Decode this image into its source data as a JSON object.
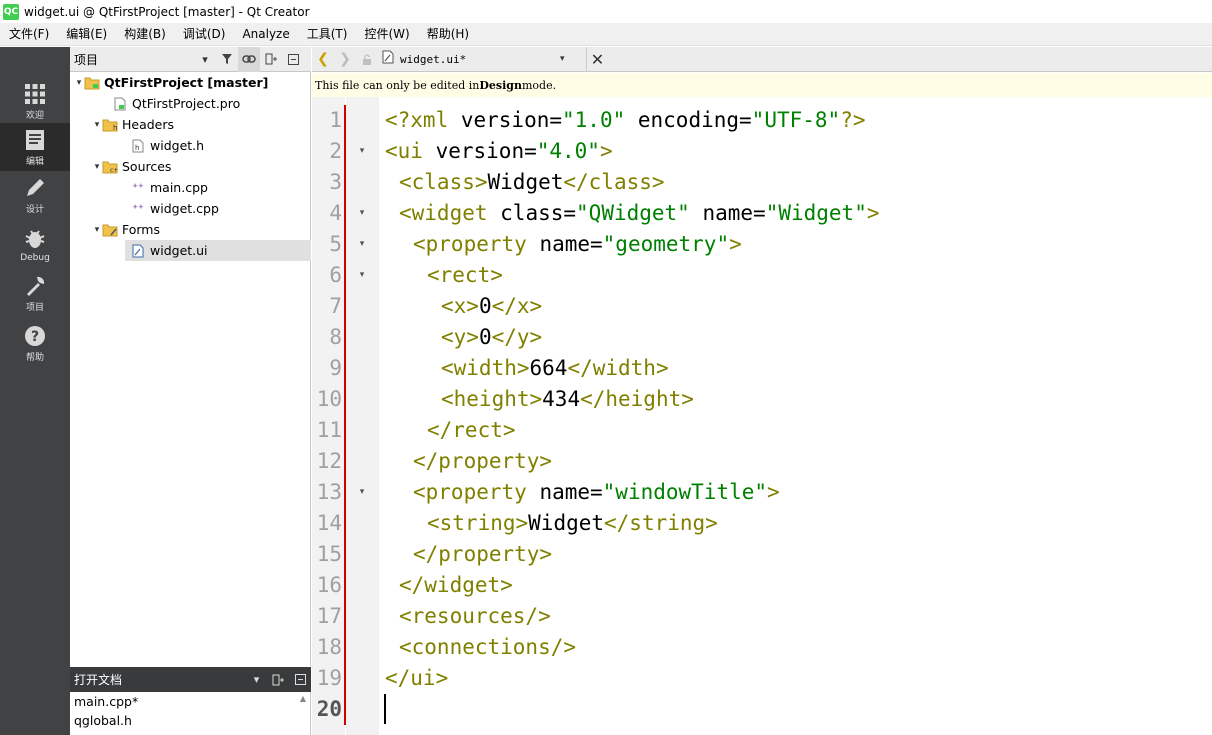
{
  "window": {
    "title": "widget.ui @ QtFirstProject [master] - Qt Creator",
    "app_icon_text": "QC"
  },
  "menu": [
    "文件(F)",
    "编辑(E)",
    "构建(B)",
    "调试(D)",
    "Analyze",
    "工具(T)",
    "控件(W)",
    "帮助(H)"
  ],
  "modes": [
    {
      "label": "欢迎",
      "icon": "grid-icon"
    },
    {
      "label": "编辑",
      "icon": "edit-document-icon"
    },
    {
      "label": "设计",
      "icon": "pencil-icon"
    },
    {
      "label": "Debug",
      "icon": "bug-icon"
    },
    {
      "label": "项目",
      "icon": "wrench-icon"
    },
    {
      "label": "帮助",
      "icon": "help-icon"
    }
  ],
  "projects_panel": {
    "title": "项目",
    "tree": [
      {
        "label": "QtFirstProject [master]",
        "kind": "project"
      },
      {
        "label": "QtFirstProject.pro",
        "kind": "pro-file"
      },
      {
        "label": "Headers",
        "kind": "folder"
      },
      {
        "label": "widget.h",
        "kind": "header-file"
      },
      {
        "label": "Sources",
        "kind": "folder"
      },
      {
        "label": "main.cpp",
        "kind": "cpp-file"
      },
      {
        "label": "widget.cpp",
        "kind": "cpp-file"
      },
      {
        "label": "Forms",
        "kind": "folder"
      },
      {
        "label": "widget.ui",
        "kind": "ui-file"
      }
    ]
  },
  "open_documents": {
    "title": "打开文档",
    "items": [
      "main.cpp*",
      "qglobal.h"
    ]
  },
  "editor": {
    "file_name": "widget.ui*",
    "info_bar": {
      "prefix": "This file can only be edited in ",
      "mode": "Design",
      "suffix": " mode."
    },
    "current_line": "20",
    "line_numbers": [
      "1",
      "2",
      "3",
      "4",
      "5",
      "6",
      "7",
      "8",
      "9",
      "10",
      "11",
      "12",
      "13",
      "14",
      "15",
      "16",
      "17",
      "18",
      "19",
      "20"
    ],
    "code": {
      "l1": {
        "decl": "<?xml",
        "a1": " version=",
        "v1": "\"1.0\"",
        "a2": " encoding=",
        "v2": "\"UTF-8\"",
        "end": "?>"
      },
      "l2": {
        "open": "<ui",
        "attr": " version=",
        "val": "\"4.0\"",
        "close": ">"
      },
      "l3": {
        "open": "<class>",
        "text": "Widget",
        "close": "</class>"
      },
      "l4": {
        "open": "<widget",
        "a1": " class=",
        "v1": "\"QWidget\"",
        "a2": " name=",
        "v2": "\"Widget\"",
        "close": ">"
      },
      "l5": {
        "open": "<property",
        "attr": " name=",
        "val": "\"geometry\"",
        "close": ">"
      },
      "l6": {
        "tag": "<rect>"
      },
      "l7": {
        "open": "<x>",
        "text": "0",
        "close": "</x>"
      },
      "l8": {
        "open": "<y>",
        "text": "0",
        "close": "</y>"
      },
      "l9": {
        "open": "<width>",
        "text": "664",
        "close": "</width>"
      },
      "l10": {
        "open": "<height>",
        "text": "434",
        "close": "</height>"
      },
      "l11": {
        "tag": "</rect>"
      },
      "l12": {
        "tag": "</property>"
      },
      "l13": {
        "open": "<property",
        "attr": " name=",
        "val": "\"windowTitle\"",
        "close": ">"
      },
      "l14": {
        "open": "<string>",
        "text": "Widget",
        "close": "</string>"
      },
      "l15": {
        "tag": "</property>"
      },
      "l16": {
        "tag": "</widget>"
      },
      "l17": {
        "tag": "<resources/>"
      },
      "l18": {
        "tag": "<connections/>"
      },
      "l19": {
        "tag": "</ui>"
      }
    }
  },
  "colors": {
    "tag": "#808000",
    "string": "#008000",
    "modebar": "#404244",
    "info_bar": "#fffde6"
  }
}
